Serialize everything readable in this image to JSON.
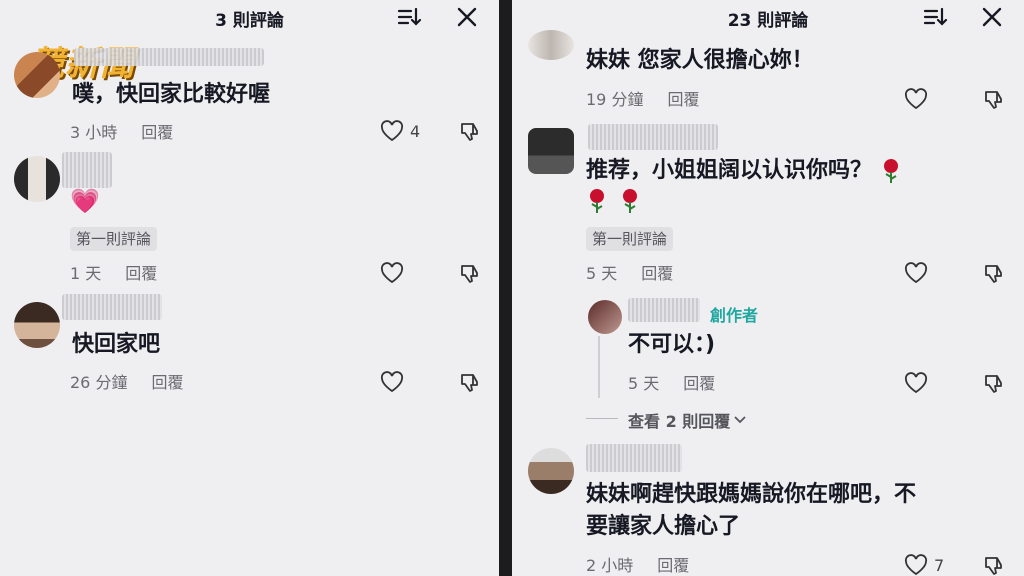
{
  "watermark": "競新聞",
  "left": {
    "title": "3 則評論",
    "comments": [
      {
        "text": "噗，快回家比較好喔",
        "time": "3 小時",
        "reply": "回覆",
        "likes": "4"
      },
      {
        "text": "💗",
        "badge": "第一則評論",
        "time": "1 天",
        "reply": "回覆",
        "likes": ""
      },
      {
        "text": "快回家吧",
        "time": "26 分鐘",
        "reply": "回覆",
        "likes": ""
      }
    ]
  },
  "right": {
    "title": "23 則評論",
    "comments": [
      {
        "text": "妹妹 您家人很擔心妳！",
        "time": "19 分鐘",
        "reply": "回覆",
        "likes": ""
      },
      {
        "text": "推荐，小姐姐阔以认识你吗？",
        "badge": "第一則評論",
        "time": "5 天",
        "reply": "回覆",
        "likes": ""
      },
      {
        "text": "不可以：)",
        "creator": "創作者",
        "time": "5 天",
        "reply": "回覆",
        "likes": ""
      },
      {
        "text_line1": "妹妹啊趕快跟媽媽說你在哪吧，不",
        "text_line2": "要讓家人擔心了",
        "time": "2 小時",
        "reply": "回覆",
        "likes": "7"
      }
    ],
    "view_more": "查看 2 則回覆"
  },
  "colors": {
    "panel_bg": "#efeff1",
    "text": "#161823",
    "meta": "#6b6b72",
    "creator": "#20a8a0",
    "divider": "#1c1c1e"
  }
}
